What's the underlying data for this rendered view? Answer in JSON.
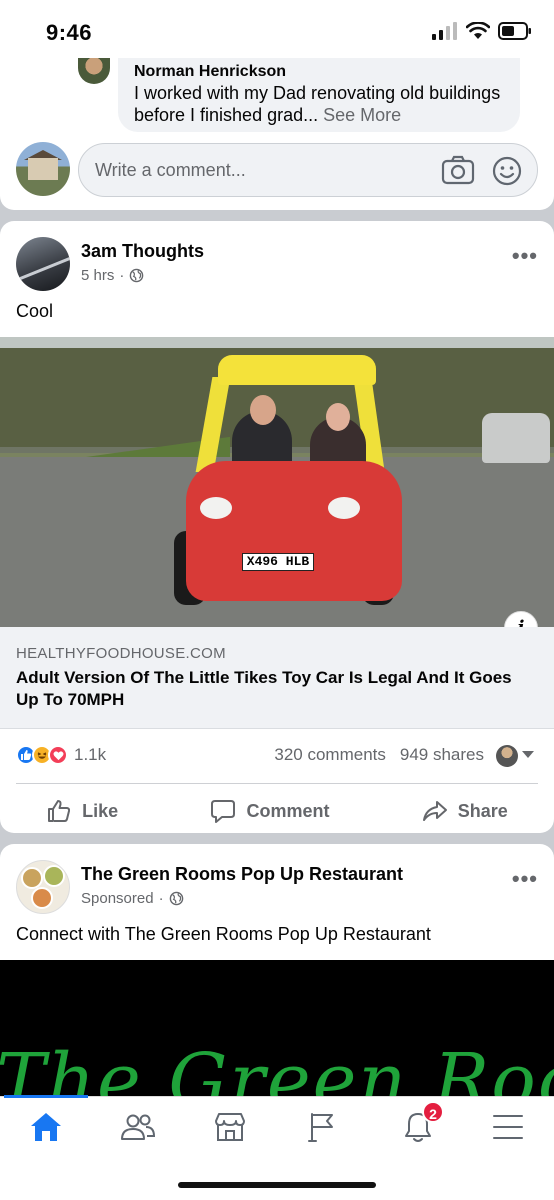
{
  "status_bar": {
    "time": "9:46"
  },
  "comment": {
    "author": "Norman Henrickson",
    "text": "I worked with my Dad renovating old buildings before I finished grad...",
    "see_more": "See More",
    "input_placeholder": "Write a comment..."
  },
  "post": {
    "author": "3am Thoughts",
    "time": "5 hrs",
    "separator": "·",
    "text": "Cool",
    "plate_text": "X496 HLB",
    "link_domain": "HEALTHYFOODHOUSE.COM",
    "link_title": "Adult Version Of The Little Tikes Toy Car Is Legal And It Goes Up To 70MPH",
    "reaction_count": "1.1k",
    "comments": "320 comments",
    "shares": "949 shares",
    "actions": {
      "like": "Like",
      "comment": "Comment",
      "share": "Share"
    }
  },
  "sponsored": {
    "author": "The Green Rooms Pop Up Restaurant",
    "label": "Sponsored",
    "separator": "·",
    "text": "Connect with The Green Rooms Pop Up Restaurant",
    "media_text": "The Green Room"
  },
  "tabbar": {
    "notifications_badge": "2",
    "active_color": "#1877f2",
    "icons": [
      "home-icon",
      "friends-icon",
      "marketplace-icon",
      "pages-flag-icon",
      "bell-icon",
      "menu-icon"
    ]
  },
  "colors": {
    "accent": "#1877f2",
    "secondary_text": "#65676b",
    "badge": "#e41e3f",
    "brand_green": "#1fa33a"
  }
}
